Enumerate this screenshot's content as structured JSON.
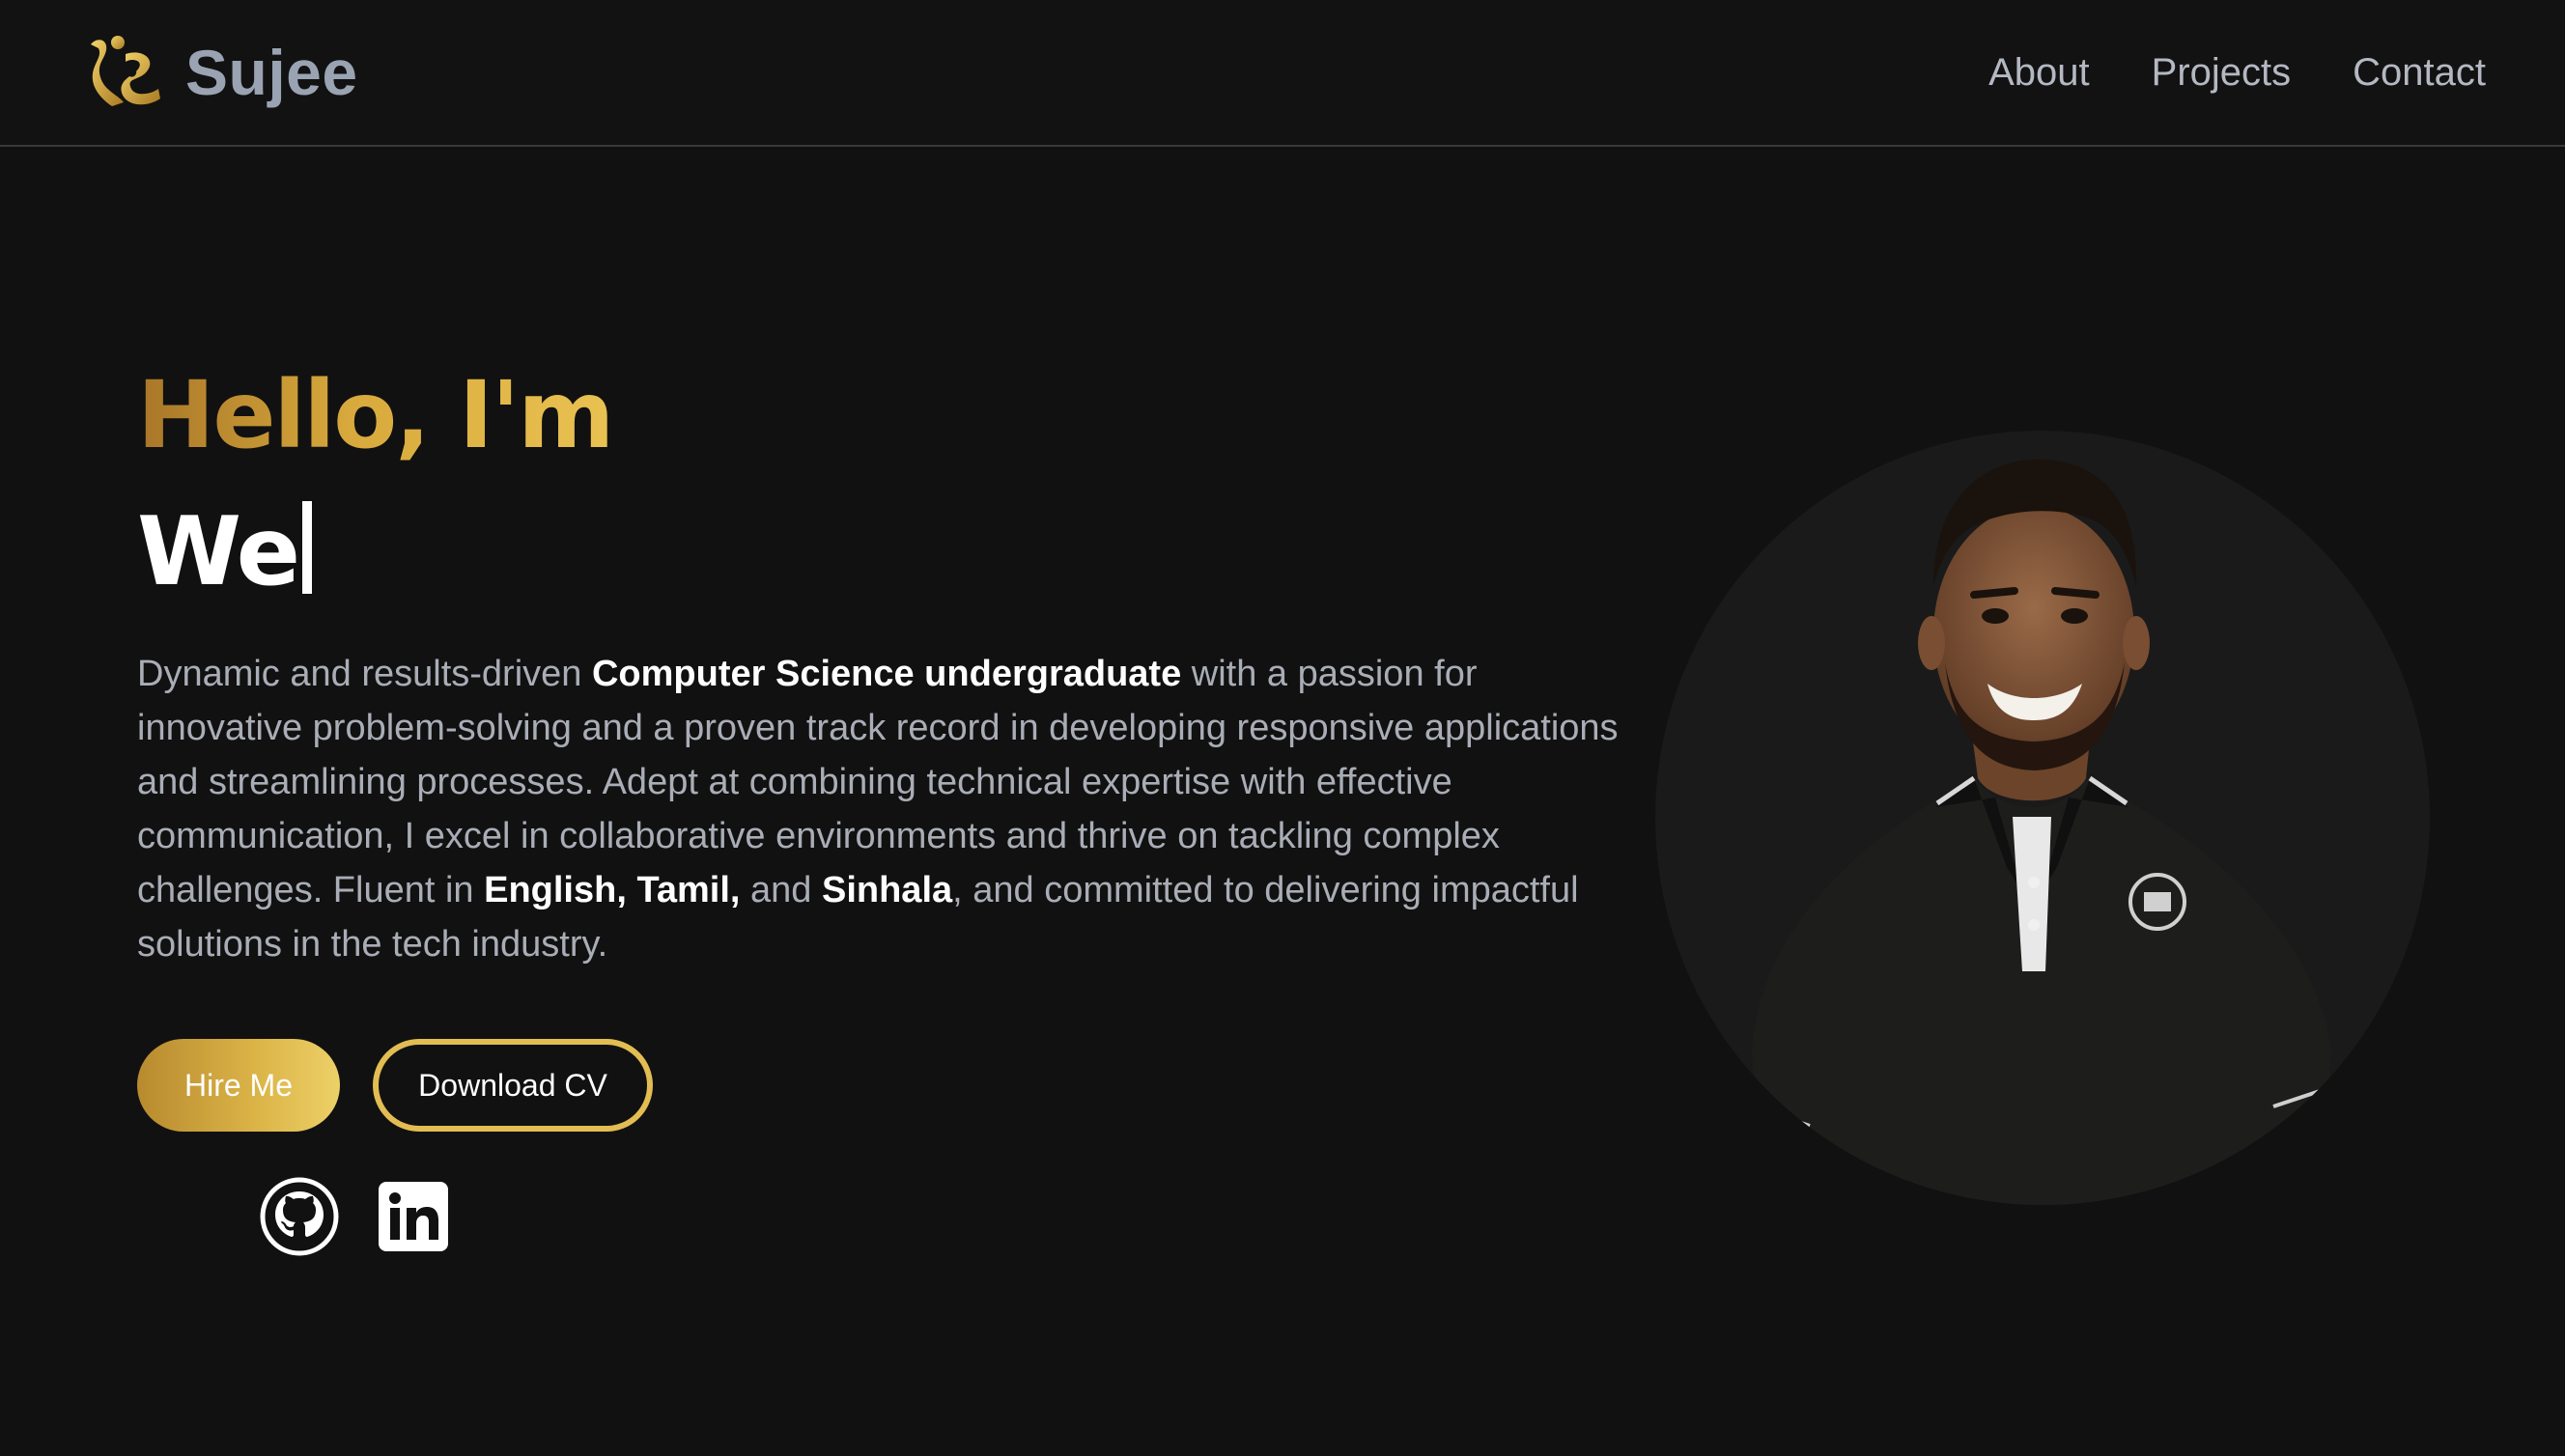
{
  "nav": {
    "brand": "Sujee",
    "links": [
      "About",
      "Projects",
      "Contact"
    ]
  },
  "hero": {
    "greeting": "Hello, I'm",
    "typed_text": "We",
    "bio": {
      "p1": "Dynamic and results-driven ",
      "b1": "Computer Science undergraduate",
      "p2": " with a passion for innovative problem-solving and a proven track record in developing responsive applications and streamlining processes. Adept at combining technical expertise with effective communication, I excel in collaborative environments and thrive on tackling complex challenges. Fluent in ",
      "b2": "English, Tamil,",
      "p3": " and ",
      "b3": "Sinhala",
      "p4": ", and committed to delivering impactful solutions in the tech industry."
    },
    "buttons": {
      "hire": "Hire Me",
      "cv": "Download CV"
    },
    "socials": [
      "github-icon",
      "linkedin-icon"
    ]
  },
  "colors": {
    "background": "#111111",
    "accent_gold": "#dcb548",
    "text_muted": "#a9adb6"
  }
}
